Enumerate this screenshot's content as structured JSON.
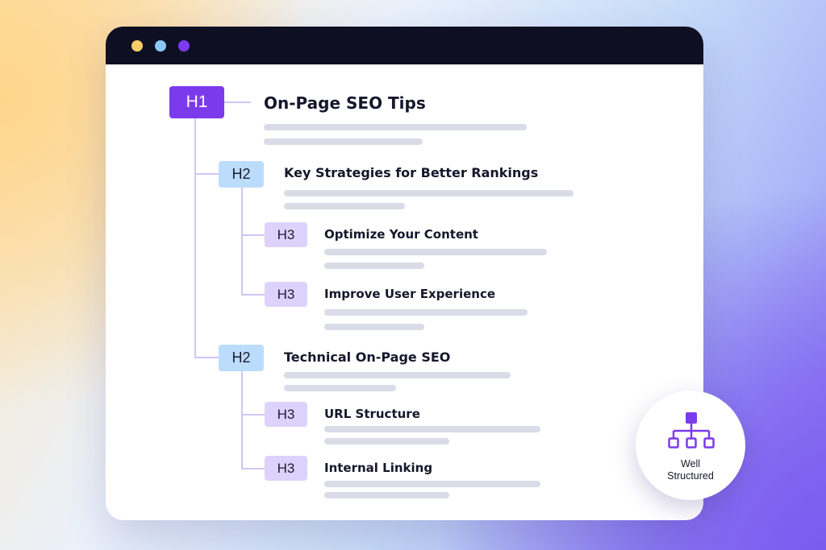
{
  "colors": {
    "accent": "#7c3aed",
    "h2_badge": "#bcdcfb",
    "h3_badge": "#ddd2fb",
    "titlebar": "#0e0f22",
    "text_placeholder_bar": "#d9dbe6"
  },
  "window": {
    "dots": [
      {
        "icon": "yellow-dot-icon",
        "color": "#f7ce6a"
      },
      {
        "icon": "blue-dot-icon",
        "color": "#8cc8f6"
      },
      {
        "icon": "purple-dot-icon",
        "color": "#7c3aed"
      }
    ]
  },
  "outline": {
    "h1": {
      "tag": "H1",
      "title": "On-Page SEO Tips"
    },
    "sections": [
      {
        "tag": "H2",
        "title": "Key Strategies for Better Rankings",
        "subsections": [
          {
            "tag": "H3",
            "title": "Optimize Your Content"
          },
          {
            "tag": "H3",
            "title": "Improve User Experience"
          }
        ]
      },
      {
        "tag": "H2",
        "title": "Technical On-Page SEO",
        "subsections": [
          {
            "tag": "H3",
            "title": "URL Structure"
          },
          {
            "tag": "H3",
            "title": "Internal Linking"
          }
        ]
      }
    ]
  },
  "seal": {
    "icon": "hierarchy-icon",
    "line1": "Well",
    "line2": "Structured"
  }
}
